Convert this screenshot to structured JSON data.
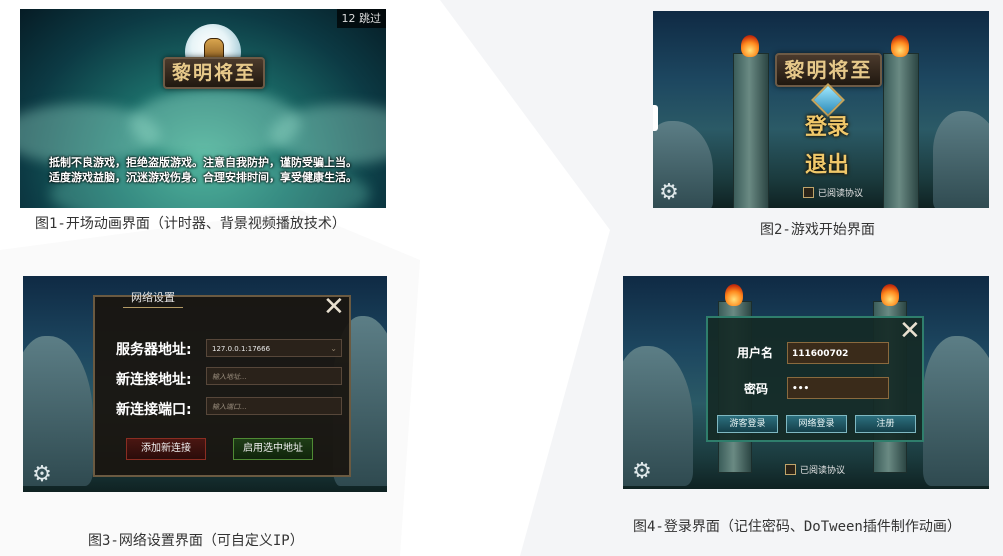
{
  "shot1": {
    "skip_count": "12",
    "skip_label": "跳过",
    "game_title": "黎明将至",
    "notice_line1": "抵制不良游戏，拒绝盗版游戏。注意自我防护，谨防受骗上当。",
    "notice_line2": "适度游戏益脑，沉迷游戏伤身。合理安排时间，享受健康生活。",
    "caption": "图1-开场动画界面（计时器、背景视频播放技术）"
  },
  "shot2": {
    "game_title": "黎明将至",
    "login_label": "登录",
    "exit_label": "退出",
    "agree_label": "已阅读协议",
    "caption": "图2-游戏开始界面"
  },
  "shot3": {
    "dialog_title": "网络设置",
    "server_label": "服务器地址:",
    "server_value": "127.0.0.1:17666",
    "new_addr_label": "新连接地址:",
    "new_addr_placeholder": "输入地址...",
    "new_port_label": "新连接端口:",
    "new_port_placeholder": "输入端口...",
    "add_button": "添加新连接",
    "use_button": "启用选中地址",
    "caption": "图3-网络设置界面（可自定义IP）"
  },
  "shot4": {
    "username_label": "用户名",
    "username_value": "111600702",
    "password_label": "密码",
    "password_value": "•••",
    "guest_button": "游客登录",
    "net_button": "网络登录",
    "register_button": "注册",
    "agree_label": "已阅读协议",
    "caption": "图4-登录界面（记住密码、DoTween插件制作动画）"
  }
}
